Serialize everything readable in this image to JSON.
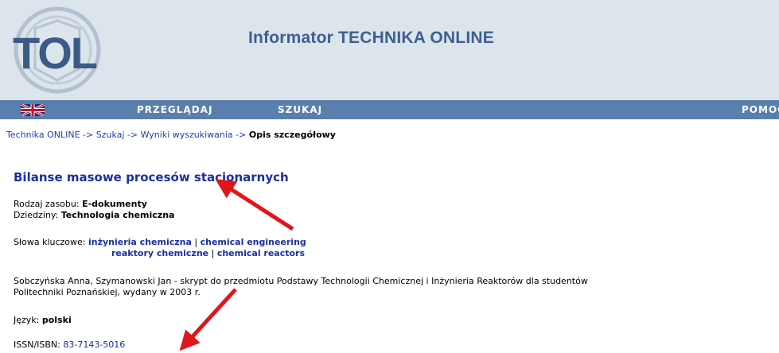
{
  "header": {
    "logo_text": "TOL",
    "site_title": "Informator TECHNIKA ONLINE"
  },
  "nav": {
    "browse": "PRZEGLĄDAJ",
    "search": "SZUKAJ",
    "help": "POMOC"
  },
  "breadcrumb": {
    "items": [
      "Technika ONLINE",
      "Szukaj",
      "Wyniki wyszukiwania"
    ],
    "separator": " -> ",
    "current": "Opis szczegółowy"
  },
  "record": {
    "title": "Bilanse masowe procesów stacjonarnych",
    "resource_type_label": "Rodzaj zasobu: ",
    "resource_type": "E-dokumenty",
    "fields_label": "Dziedziny: ",
    "fields": "Technologia chemiczna",
    "keywords_label": "Słowa kluczowe: ",
    "keywords_row1": [
      "inżynieria chemiczna",
      "chemical engineering"
    ],
    "keywords_row2": [
      "reaktory chemiczne",
      "chemical reactors"
    ],
    "keyword_separator": " | ",
    "description_line1": "Sobczyńska Anna, Szymanowski Jan - skrypt do przedmiotu Podstawy Technologii Chemicznej i Inżynieria Reaktorów dla studentów",
    "description_line2": "Politechniki Poznańskiej, wydany w 2003 r.",
    "language_label": "Język: ",
    "language": "polski",
    "isbn_label": "ISSN/ISBN: ",
    "isbn": "83-7143-5016"
  },
  "colors": {
    "header_bg": "#dce4ec",
    "nav_bg": "#5a7fad",
    "link": "#1a2ea3",
    "arrow": "#e0161b"
  }
}
